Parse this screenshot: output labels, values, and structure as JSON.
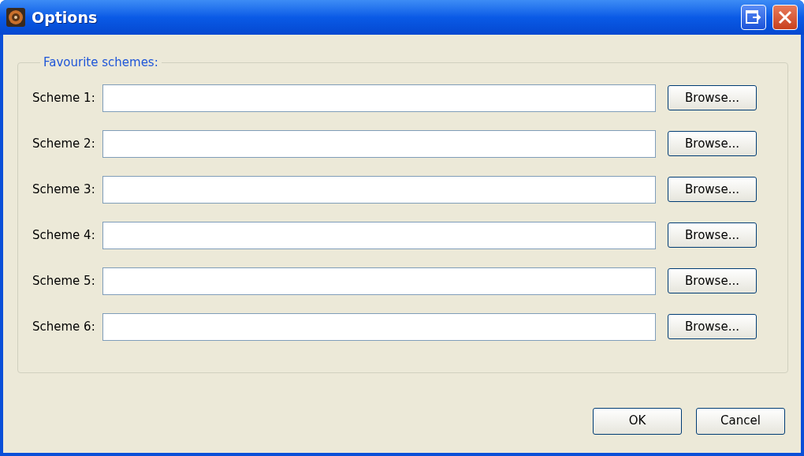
{
  "window": {
    "title": "Options"
  },
  "group": {
    "legend": "Favourite schemes:",
    "rows": [
      {
        "label": "Scheme 1:",
        "button": "Browse..."
      },
      {
        "label": "Scheme 2:",
        "button": "Browse..."
      },
      {
        "label": "Scheme 3:",
        "button": "Browse..."
      },
      {
        "label": "Scheme 4:",
        "button": "Browse..."
      },
      {
        "label": "Scheme 5:",
        "button": "Browse..."
      },
      {
        "label": "Scheme 6:",
        "button": "Browse..."
      }
    ]
  },
  "buttons": [
    "OK",
    "Cancel"
  ]
}
